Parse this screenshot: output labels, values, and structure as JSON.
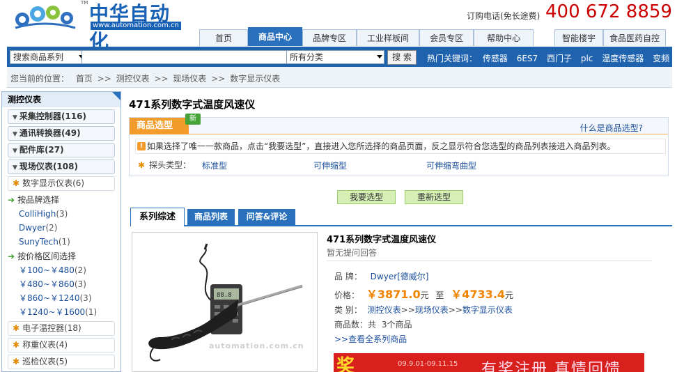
{
  "header": {
    "brand": "中华自动化",
    "url": "www.automation.com.cn",
    "tm": "TM",
    "hotline_label": "订购电话(免长途费)",
    "hotline_number": "400 672 8859"
  },
  "nav": {
    "tabs": [
      "首页",
      "商品中心",
      "品牌专区",
      "工业样板间",
      "会员专区",
      "帮助中心"
    ],
    "active": "商品中心",
    "extra_tabs": [
      "智能楼宇",
      "食品医药自控"
    ]
  },
  "search": {
    "type_select": "搜索商品系列",
    "query": "",
    "category_select": "所有分类",
    "button": "搜 索",
    "hot_label": "热门关键词：",
    "hot_keywords": [
      "传感器",
      "6ES7",
      "西门子",
      "plc",
      "温度传感器",
      "变频"
    ]
  },
  "breadcrumb": {
    "label": "您当前的位置：",
    "items": [
      "首页",
      "测控仪表",
      "现场仪表",
      "数字显示仪表"
    ],
    "sep": ">>"
  },
  "sidebar": {
    "title": "测控仪表",
    "categories": [
      {
        "label": "采集控制器",
        "count": "(116)"
      },
      {
        "label": "通讯转换器",
        "count": "(49)"
      },
      {
        "label": "配件库",
        "count": "(27)"
      },
      {
        "label": "现场仪表",
        "count": "(108)"
      }
    ],
    "current_sub": {
      "label": "数字显示仪表",
      "count": "(6)"
    },
    "brand_group": "按品牌选择",
    "brands": [
      {
        "label": "ColliHigh",
        "count": "(3)"
      },
      {
        "label": "Dwyer",
        "count": "(2)"
      },
      {
        "label": "SunyTech",
        "count": "(1)"
      }
    ],
    "price_group": "按价格区间选择",
    "price_ranges": [
      {
        "label": "￥100~￥480",
        "count": "(2)"
      },
      {
        "label": "￥480~￥860",
        "count": "(3)"
      },
      {
        "label": "￥860~￥1240",
        "count": "(3)"
      },
      {
        "label": "￥1240~￥1600",
        "count": "(1)"
      }
    ],
    "other_subs": [
      {
        "label": "电子温控器",
        "count": "(18)"
      },
      {
        "label": "称重仪表",
        "count": "(4)"
      },
      {
        "label": "巡检仪表",
        "count": "(5)"
      }
    ]
  },
  "main": {
    "title": "471系列数字式温度风速仪",
    "selection": {
      "tab": "商品选型",
      "new_badge": "新",
      "what_link": "什么是商品选型?",
      "note": "如果选择了唯一一款商品，点击“我要选型”，直接进入您所选择的商品页面，反之显示符合您选型的商品列表接进入商品列表。",
      "probe_label": "探头类型：",
      "probe_options": [
        "标准型",
        "可伸缩型",
        "可伸缩弯曲型"
      ]
    },
    "buttons": {
      "select": "我要选型",
      "reselect": "重新选型"
    },
    "product_tabs": [
      "系列综述",
      "商品列表",
      "问答&评论"
    ],
    "product": {
      "name": "471系列数字式温度风速仪",
      "qa_status": "暂无提问回答",
      "brand_label": "品  牌：",
      "brand_value": "Dwyer[德威尔]",
      "price_label": "价格：",
      "price_low": "￥3871.0",
      "price_unit_1": "元",
      "price_to": "至",
      "price_high": "￥4733.4",
      "price_unit_2": "元",
      "category_label": "类  别：",
      "category_path": [
        "测控仪表",
        "现场仪表",
        "数字显示仪表"
      ],
      "count_label": "商品数：共",
      "count_value": "3个商品",
      "view_all": ">>查看全系列商品",
      "watermark": "automation.com.cn"
    },
    "banner": {
      "big": "奖",
      "dates": "09.9.01-09.11.15",
      "slogan": "有奖注册 真情回馈"
    }
  },
  "colors": {
    "brand_blue": "#1660b5",
    "nav_blue": "#2a71bd",
    "hotline_red": "#cc0000",
    "price_orange": "#f08300"
  }
}
